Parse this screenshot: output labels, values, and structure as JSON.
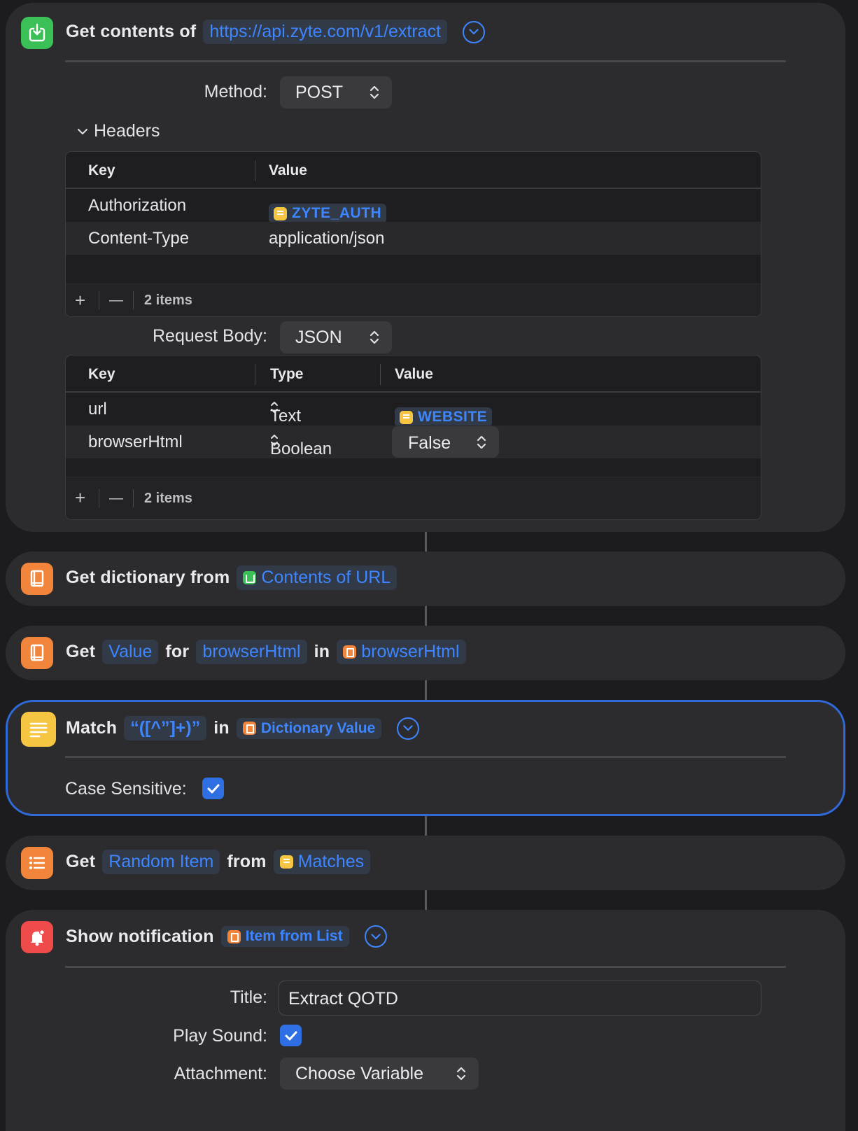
{
  "colors": {
    "background": "#1c1c1e",
    "card": "#2c2c2f",
    "accent": "#3e86ff",
    "selected_border": "#2f6ad8",
    "web_icon": "#3bbf57",
    "dictionary_icon": "#f0853b",
    "text_icon": "#f6c642",
    "notification_icon": "#ef4b4b"
  },
  "get_contents": {
    "icon": "download-web-icon",
    "label": "Get contents of",
    "url": "https://api.zyte.com/v1/extract",
    "method_label": "Method:",
    "method_value": "POST",
    "headers_label": "Headers",
    "headers_table": {
      "col_key": "Key",
      "col_value": "Value",
      "rows": [
        {
          "key": "Authorization",
          "value": "ZYTE_AUTH"
        },
        {
          "key": "Content-Type",
          "value": "application/json"
        }
      ],
      "add": "+",
      "remove": "—",
      "count": "2 items"
    },
    "body_label": "Request Body:",
    "body_value": "JSON",
    "body_table": {
      "col_key": "Key",
      "col_type": "Type",
      "col_value": "Value",
      "rows": [
        {
          "key": "url",
          "type": "Text",
          "value": "WEBSITE"
        },
        {
          "key": "browserHtml",
          "type": "Boolean",
          "value": "False"
        }
      ],
      "add": "+",
      "remove": "—",
      "count": "2 items"
    }
  },
  "get_dictionary": {
    "icon": "dictionary-icon",
    "label": "Get dictionary from",
    "source": "Contents of URL"
  },
  "get_value": {
    "icon": "dictionary-icon",
    "label_get": "Get",
    "value": "Value",
    "label_for": "for",
    "key": "browserHtml",
    "label_in": "in",
    "source": "browserHtml"
  },
  "match": {
    "icon": "text-icon",
    "label": "Match",
    "pattern": "“([^”]+)”",
    "label_in": "in",
    "source": "Dictionary Value",
    "case_label": "Case Sensitive:",
    "case_checked": true
  },
  "get_item": {
    "icon": "list-icon",
    "label_get": "Get",
    "item": "Random Item",
    "label_from": "from",
    "source": "Matches"
  },
  "notification": {
    "icon": "notification-icon",
    "label": "Show notification",
    "source": "Item from List",
    "title_label": "Title:",
    "title_value": "Extract QOTD",
    "sound_label": "Play Sound:",
    "sound_checked": true,
    "attachment_label": "Attachment:",
    "attachment_value": "Choose Variable"
  }
}
